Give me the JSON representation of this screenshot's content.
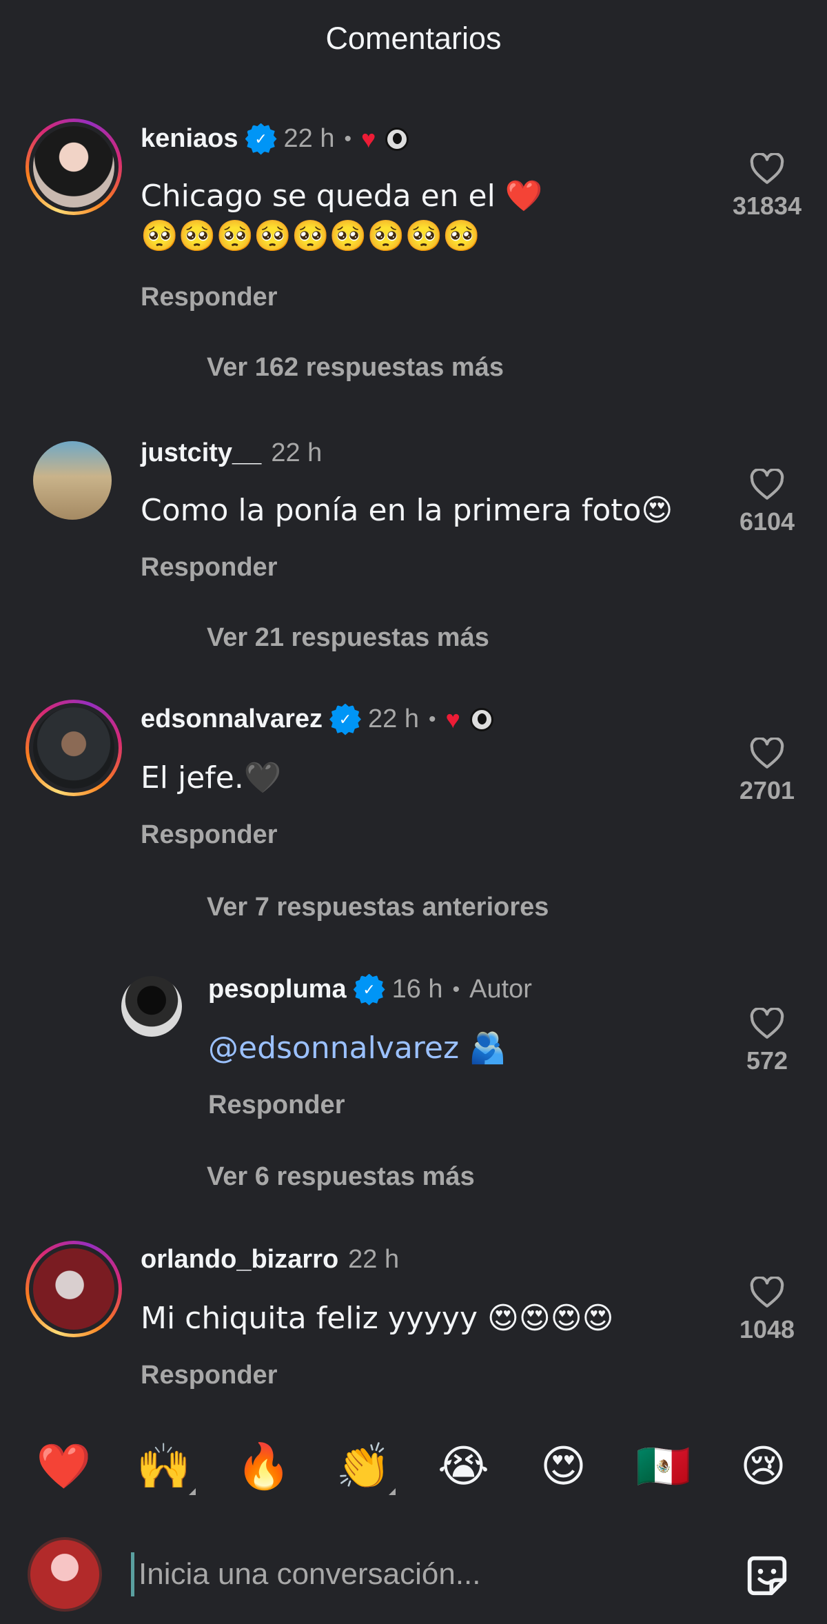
{
  "header": {
    "title": "Comentarios"
  },
  "comments": [
    {
      "username": "keniaos",
      "verified": true,
      "time": "22 h",
      "liked_by_author": true,
      "text_line1": "Chicago se queda en el ❤️",
      "text_line2": "🥺🥺🥺🥺🥺🥺🥺🥺🥺",
      "reply_label": "Responder",
      "likes": "31834",
      "view_more": "Ver 162 respuestas más"
    },
    {
      "username": "justcity__",
      "verified": false,
      "time": "22 h",
      "text_line1": "Como la ponía en la primera foto😍",
      "reply_label": "Responder",
      "likes": "6104",
      "view_more": "Ver 21 respuestas más"
    },
    {
      "username": "edsonnalvarez",
      "verified": true,
      "time": "22 h",
      "liked_by_author": true,
      "text_line1": "El jefe.🖤",
      "reply_label": "Responder",
      "likes": "2701",
      "view_more": "Ver 7 respuestas anteriores"
    },
    {
      "username": "pesopluma",
      "verified": true,
      "time": "16 h",
      "author_label": "Autor",
      "mention": "@edsonnalvarez",
      "text_line1": " 🫂",
      "reply_label": "Responder",
      "likes": "572",
      "view_more": "Ver 6 respuestas más"
    },
    {
      "username": "orlando_bizarro",
      "verified": false,
      "time": "22 h",
      "text_line1": "Mi chiquita feliz yyyyy 😍😍😍😍",
      "reply_label": "Responder",
      "likes": "1048"
    }
  ],
  "emoji_bar": [
    "❤️",
    "🙌",
    "🔥",
    "👏",
    "😭",
    "😍",
    "🇲🇽",
    "😢"
  ],
  "composer": {
    "placeholder": "Inicia una conversación..."
  },
  "colors": {
    "background": "#232428",
    "verified": "#0095f6",
    "heart": "#ed1c36",
    "mention": "#9bc1ff"
  }
}
